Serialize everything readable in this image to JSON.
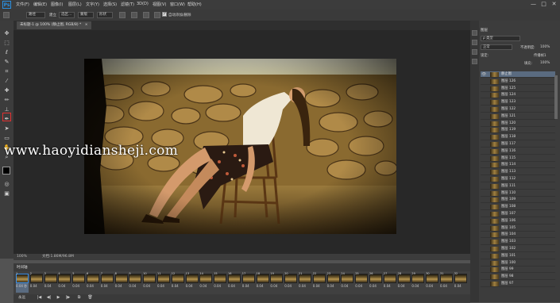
{
  "app": {
    "logo": "Ps",
    "menus": [
      "文件(F)",
      "编辑(E)",
      "图像(I)",
      "图层(L)",
      "文字(Y)",
      "选择(S)",
      "滤镜(T)",
      "3D(D)",
      "视图(V)",
      "窗口(W)",
      "帮助(H)"
    ],
    "window_controls": {
      "minimize": "—",
      "restore": "□",
      "close": "✕"
    }
  },
  "options_bar": {
    "preset": "路径",
    "make_label": "建立",
    "select_label": "选区...",
    "mask_label": "蒙版",
    "shape_label": "形状",
    "auto_add_delete": "自动添加/删除",
    "auto_checked": true
  },
  "document": {
    "tab_title": "未标题-1 @ 100% (静止图, RGB/8) *",
    "tab_close": "×"
  },
  "status": {
    "zoom": "100%",
    "doc_info": "文档:1.86M/96.8M"
  },
  "watermark": "www.haoyidiansheji.com",
  "timeline": {
    "title": "时间轴",
    "frames": [
      {
        "num": "1",
        "delay": "0.04 秒"
      },
      {
        "num": "2",
        "delay": "0.04"
      },
      {
        "num": "3",
        "delay": "0.04"
      },
      {
        "num": "4",
        "delay": "0.04"
      },
      {
        "num": "5",
        "delay": "0.04"
      },
      {
        "num": "6",
        "delay": "0.04"
      },
      {
        "num": "7",
        "delay": "0.04"
      },
      {
        "num": "8",
        "delay": "0.04"
      },
      {
        "num": "9",
        "delay": "0.04"
      },
      {
        "num": "10",
        "delay": "0.04"
      },
      {
        "num": "11",
        "delay": "0.04"
      },
      {
        "num": "12",
        "delay": "0.04"
      },
      {
        "num": "13",
        "delay": "0.04"
      },
      {
        "num": "14",
        "delay": "0.04"
      },
      {
        "num": "15",
        "delay": "0.04"
      },
      {
        "num": "16",
        "delay": "0.04"
      },
      {
        "num": "17",
        "delay": "0.04"
      },
      {
        "num": "18",
        "delay": "0.04"
      },
      {
        "num": "19",
        "delay": "0.04"
      },
      {
        "num": "20",
        "delay": "0.04"
      },
      {
        "num": "21",
        "delay": "0.04"
      },
      {
        "num": "22",
        "delay": "0.04"
      },
      {
        "num": "23",
        "delay": "0.04"
      },
      {
        "num": "24",
        "delay": "0.04"
      },
      {
        "num": "25",
        "delay": "0.04"
      },
      {
        "num": "26",
        "delay": "0.04"
      },
      {
        "num": "27",
        "delay": "0.04"
      },
      {
        "num": "28",
        "delay": "0.04"
      },
      {
        "num": "29",
        "delay": "0.04"
      },
      {
        "num": "30",
        "delay": "0.04"
      },
      {
        "num": "31",
        "delay": "0.04"
      },
      {
        "num": "32",
        "delay": "0.04"
      }
    ],
    "loop": "永远",
    "controls": [
      "|◀",
      "◀|",
      "▶",
      "|▶",
      "⧉",
      "🗑"
    ]
  },
  "panels": {
    "layers_tab": "图层",
    "kind_filter": "ρ 类型",
    "blend_mode": "正常",
    "opacity_label": "不透明度:",
    "opacity_value": "100%",
    "lock_label": "锁定:",
    "fill_label": "填充:",
    "fill_value": "100%",
    "propagate": "传播帧1",
    "layers": [
      "静止图",
      "图层 126",
      "图层 125",
      "图层 124",
      "图层 123",
      "图层 122",
      "图层 121",
      "图层 120",
      "图层 119",
      "图层 118",
      "图层 117",
      "图层 116",
      "图层 115",
      "图层 114",
      "图层 113",
      "图层 112",
      "图层 111",
      "图层 110",
      "图层 109",
      "图层 108",
      "图层 107",
      "图层 106",
      "图层 105",
      "图层 104",
      "图层 103",
      "图层 102",
      "图层 101",
      "图层 100",
      "图层 99",
      "图层 98",
      "图层 97"
    ]
  },
  "colors": {
    "accent": "#2a8fe0",
    "active_tool_highlight": "#e03030",
    "selected_row": "#5a6b80"
  }
}
